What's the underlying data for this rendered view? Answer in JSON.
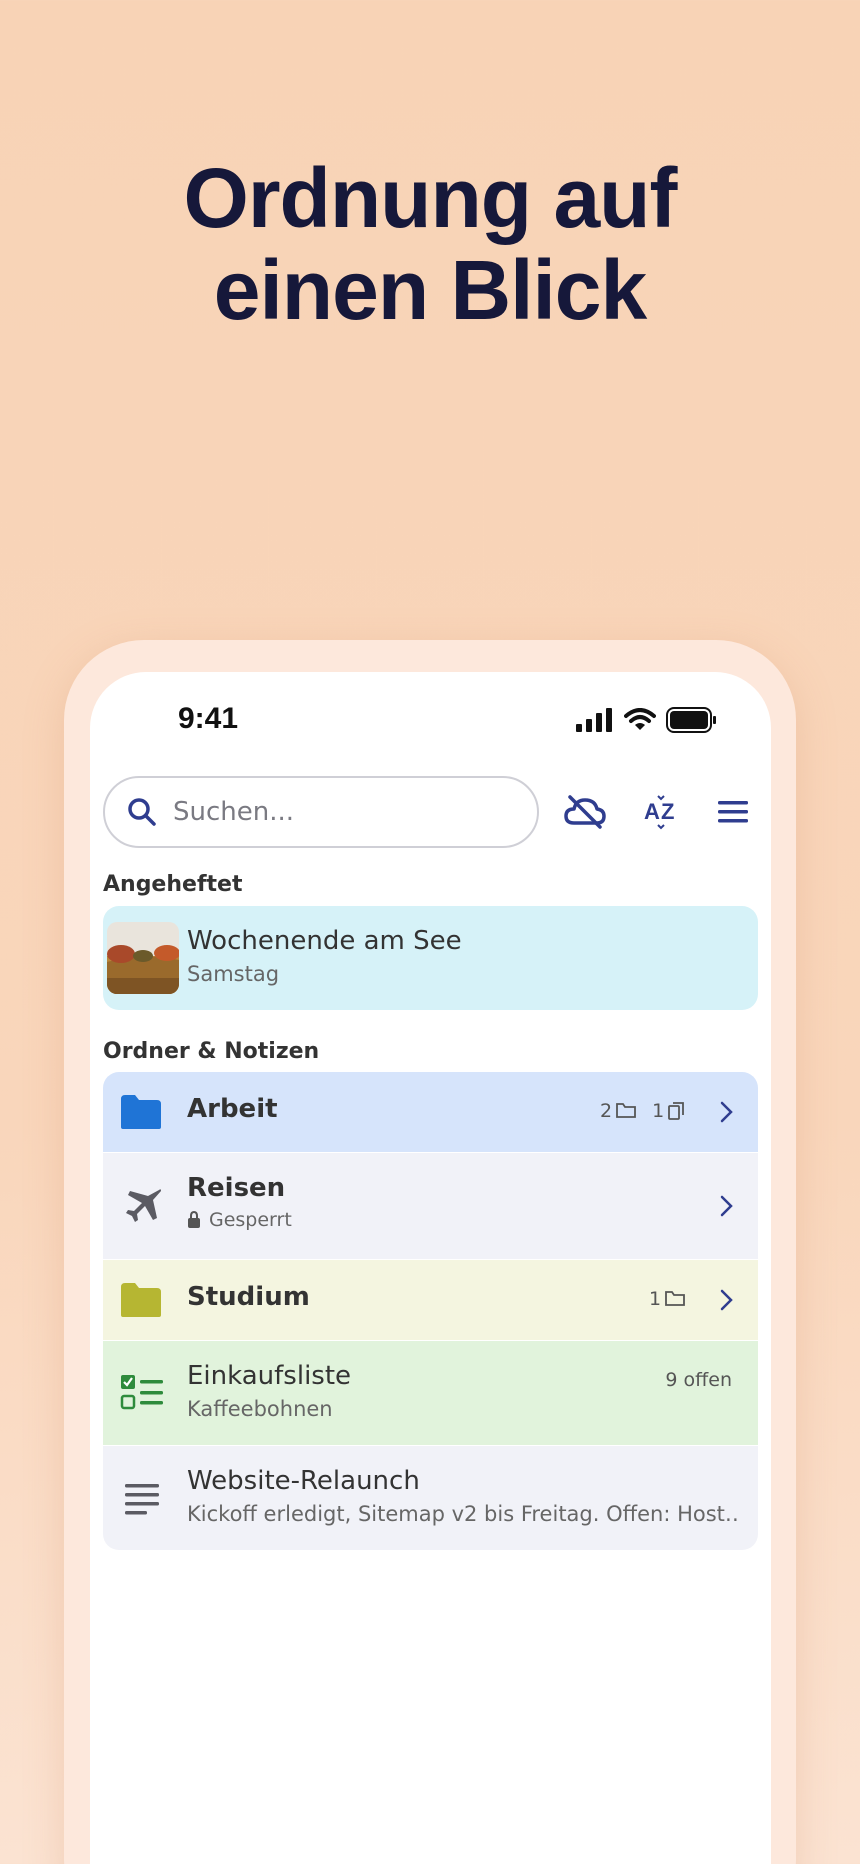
{
  "headline": {
    "line1": "Ordnung auf",
    "line2": "einen Blick"
  },
  "status_bar": {
    "time": "9:41"
  },
  "search": {
    "placeholder": "Suchen..."
  },
  "sections": {
    "pinned": "Angeheftet",
    "folders": "Ordner & Notizen"
  },
  "pinned_item": {
    "title": "Wochenende am See",
    "subtitle": "Samstag"
  },
  "items": [
    {
      "title": "Arbeit",
      "folder_count": "2",
      "note_count": "1",
      "color": "#d6e4fb",
      "icon": "folder-icon"
    },
    {
      "title": "Reisen",
      "subtitle": "Gesperrt",
      "color": "#f1f2f8",
      "icon": "airplane-icon"
    },
    {
      "title": "Studium",
      "folder_count": "1",
      "color": "#f4f5e0",
      "icon": "folder-icon"
    },
    {
      "title": "Einkaufsliste",
      "subtitle": "Kaffeebohnen",
      "meta": "9 offen",
      "color": "#e1f3dc",
      "icon": "checklist-icon"
    },
    {
      "title": "Website-Relaunch",
      "subtitle": "Kickoff erledigt, Sitemap v2 bis Freitag. Offen: Host…",
      "color": "#f1f2f8",
      "icon": "note-lines-icon"
    }
  ],
  "colors": {
    "accent": "#2f3d8f",
    "pinned_bg": "#d6f2f8",
    "headline": "#16183a"
  }
}
